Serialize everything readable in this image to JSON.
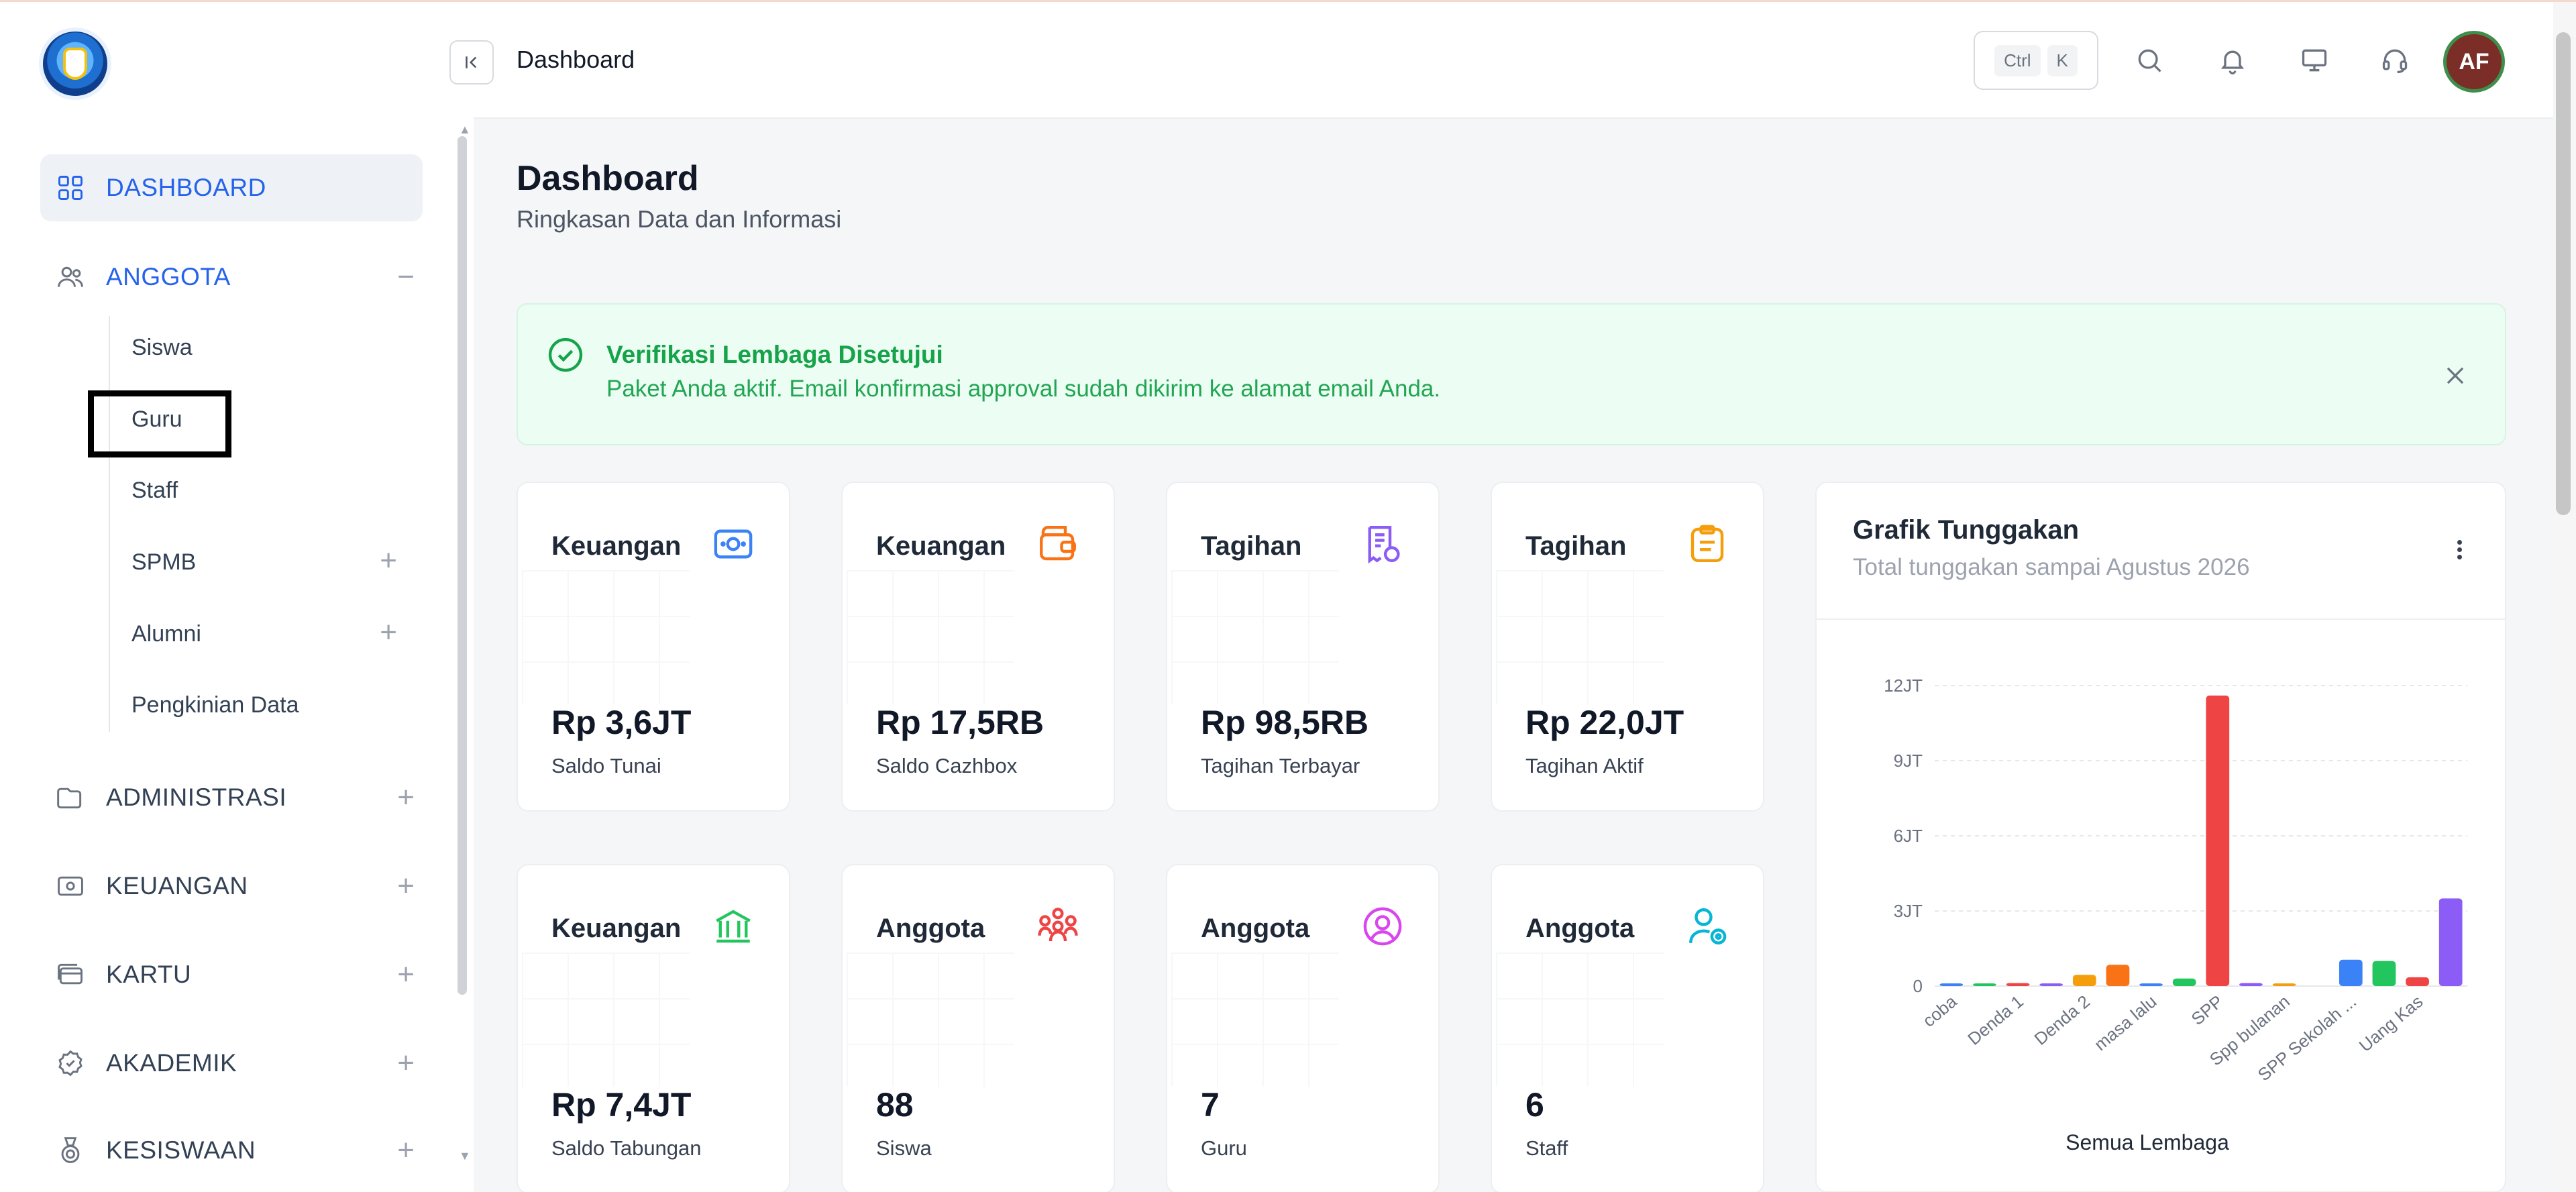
{
  "header": {
    "title": "Dashboard",
    "shortcut": [
      "Ctrl",
      "K"
    ],
    "avatar_initials": "AF"
  },
  "sidebar": {
    "items": [
      {
        "label": "DASHBOARD",
        "icon": "grid-icon",
        "state": "active"
      },
      {
        "label": "ANGGOTA",
        "icon": "users-icon",
        "state": "open",
        "toggle": "−"
      },
      {
        "label": "ADMINISTRASI",
        "icon": "folder-icon",
        "toggle": "+"
      },
      {
        "label": "KEUANGAN",
        "icon": "money-icon",
        "toggle": "+"
      },
      {
        "label": "KARTU",
        "icon": "card-icon",
        "toggle": "+"
      },
      {
        "label": "AKADEMIK",
        "icon": "badge-icon",
        "toggle": "+"
      },
      {
        "label": "KESISWAAN",
        "icon": "medal-icon",
        "toggle": "+"
      }
    ],
    "sub_items": [
      {
        "label": "Siswa"
      },
      {
        "label": "Guru",
        "highlighted": true
      },
      {
        "label": "Staff"
      },
      {
        "label": "SPMB",
        "toggle": "+"
      },
      {
        "label": "Alumni",
        "toggle": "+"
      },
      {
        "label": "Pengkinian Data"
      }
    ]
  },
  "page": {
    "title": "Dashboard",
    "subtitle": "Ringkasan Data dan Informasi"
  },
  "alert": {
    "title": "Verifikasi Lembaga Disetujui",
    "text": "Paket Anda aktif. Email konfirmasi approval sudah dikirim ke alamat email Anda."
  },
  "cards": [
    {
      "title": "Keuangan",
      "value": "Rp 3,6JT",
      "label": "Saldo Tunai",
      "icon": "cash-icon",
      "color": "#3b82f6"
    },
    {
      "title": "Keuangan",
      "value": "Rp 17,5RB",
      "label": "Saldo Cazhbox",
      "icon": "wallet-icon",
      "color": "#f97316"
    },
    {
      "title": "Tagihan",
      "value": "Rp 98,5RB",
      "label": "Tagihan Terbayar",
      "icon": "receipt-icon",
      "color": "#8b5cf6"
    },
    {
      "title": "Tagihan",
      "value": "Rp 22,0JT",
      "label": "Tagihan Aktif",
      "icon": "clipboard-icon",
      "color": "#f59e0b"
    },
    {
      "title": "Keuangan",
      "value": "Rp 7,4JT",
      "label": "Saldo Tabungan",
      "icon": "bank-icon",
      "color": "#22c55e"
    },
    {
      "title": "Anggota",
      "value": "88",
      "label": "Siswa",
      "icon": "group-icon",
      "color": "#ef4444"
    },
    {
      "title": "Anggota",
      "value": "7",
      "label": "Guru",
      "icon": "user-circle-icon",
      "color": "#d946ef"
    },
    {
      "title": "Anggota",
      "value": "6",
      "label": "Staff",
      "icon": "user-settings-icon",
      "color": "#06b6d4"
    }
  ],
  "chart_card": {
    "title": "Grafik Tunggakan",
    "subtitle": "Total tunggakan sampai Agustus 2026"
  },
  "chart_data": {
    "type": "bar",
    "title": "Grafik Tunggakan",
    "subtitle": "Total tunggakan sampai Agustus 2026",
    "xlabel": "Semua Lembaga",
    "ylabel": "",
    "ylim": [
      0,
      12000000
    ],
    "yticks": [
      0,
      3000000,
      6000000,
      9000000,
      12000000
    ],
    "ytick_labels": [
      "0",
      "3JT",
      "6JT",
      "9JT",
      "12JT"
    ],
    "grid": true,
    "categories": [
      "coba",
      "",
      "Denda 1",
      "",
      "Denda 2",
      "",
      "masa lalu",
      "",
      "SPP",
      "",
      "Spp bulanan",
      "",
      "SPP Sekolah ...",
      "",
      "Uang Kas"
    ],
    "values": [
      60000,
      60000,
      120000,
      60000,
      450000,
      850000,
      40000,
      300000,
      11600000,
      120000,
      60000,
      0,
      1050000,
      1000000,
      350000,
      3500000
    ],
    "x_tick_labels": [
      "coba",
      "Denda 1",
      "Denda 2",
      "masa lalu",
      "SPP",
      "Spp bulanan",
      "SPP Sekolah ...",
      "Uang Kas"
    ],
    "colors": [
      "#3b82f6",
      "#22c55e",
      "#ef4444",
      "#8b5cf6",
      "#f59e0b",
      "#f97316",
      "#3b82f6",
      "#22c55e",
      "#ef4444",
      "#8b5cf6",
      "#f59e0b",
      "#f97316",
      "#3b82f6",
      "#22c55e",
      "#ef4444",
      "#8b5cf6"
    ]
  }
}
